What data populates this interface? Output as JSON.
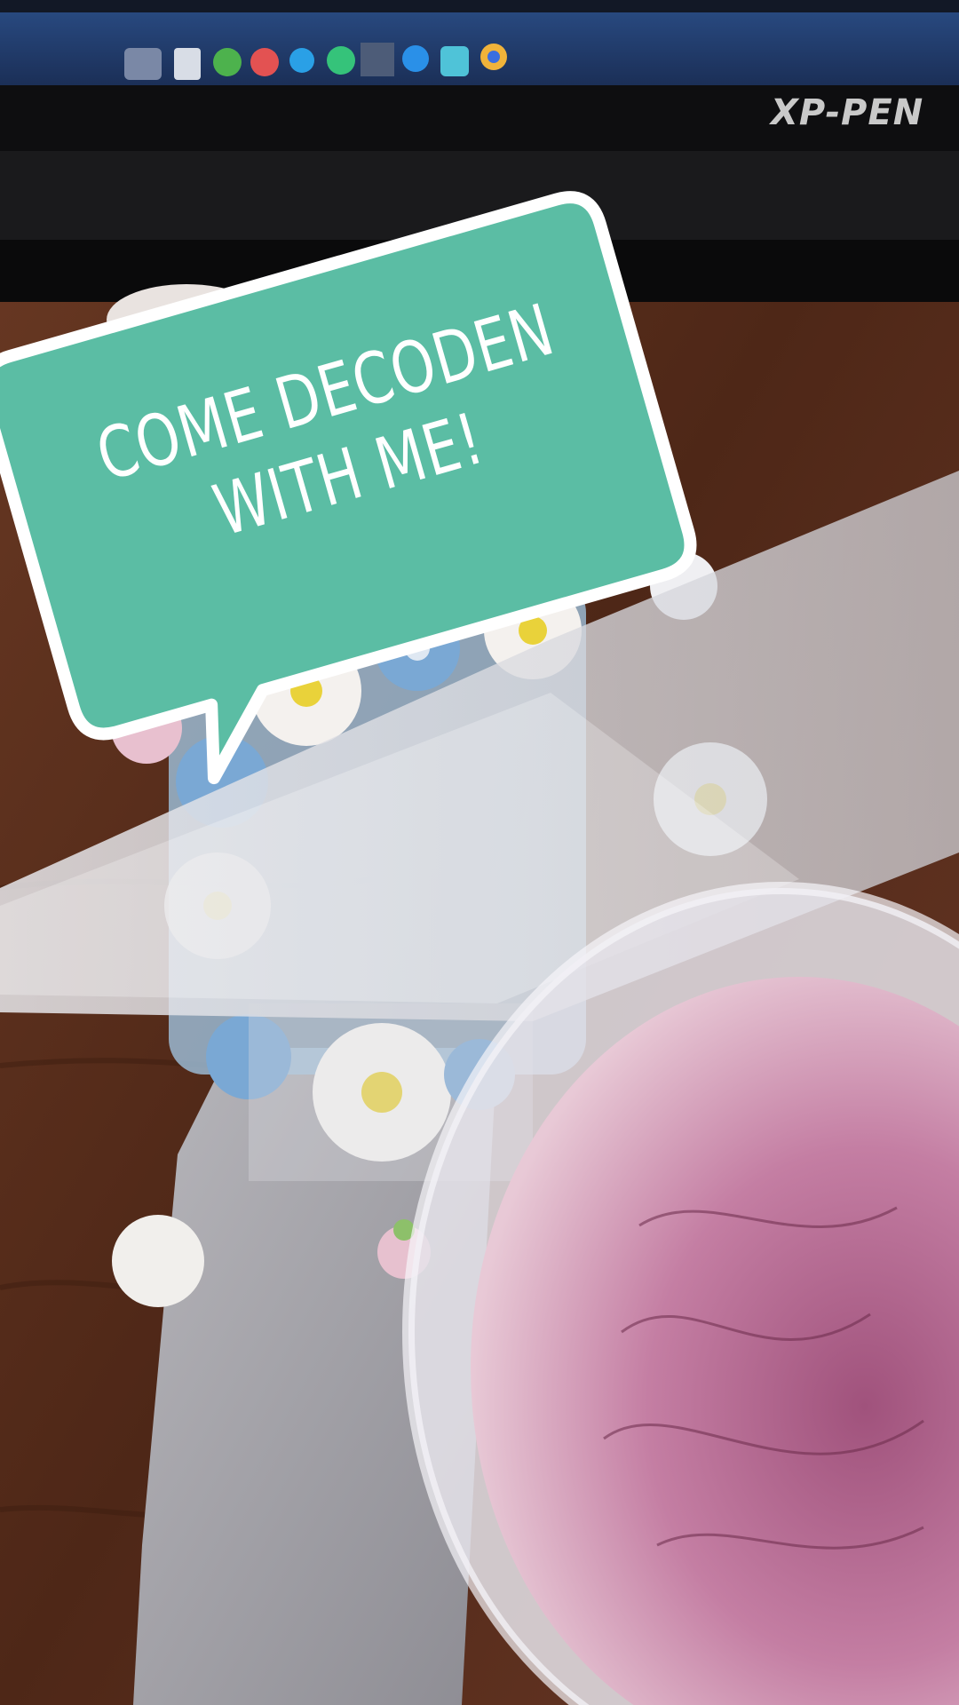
{
  "overlay": {
    "line1": "COME DECODEN",
    "line2": "WITH ME!",
    "bubble_color": "#5bbda4",
    "bubble_border_color": "#ffffff"
  },
  "monitor": {
    "brand": "XP-PEN"
  },
  "colors": {
    "desk_wood": "#5a2e1c",
    "mat": "#9a9aa0",
    "frosting": "#c98aa8",
    "daisy_center": "#e9d23a"
  }
}
